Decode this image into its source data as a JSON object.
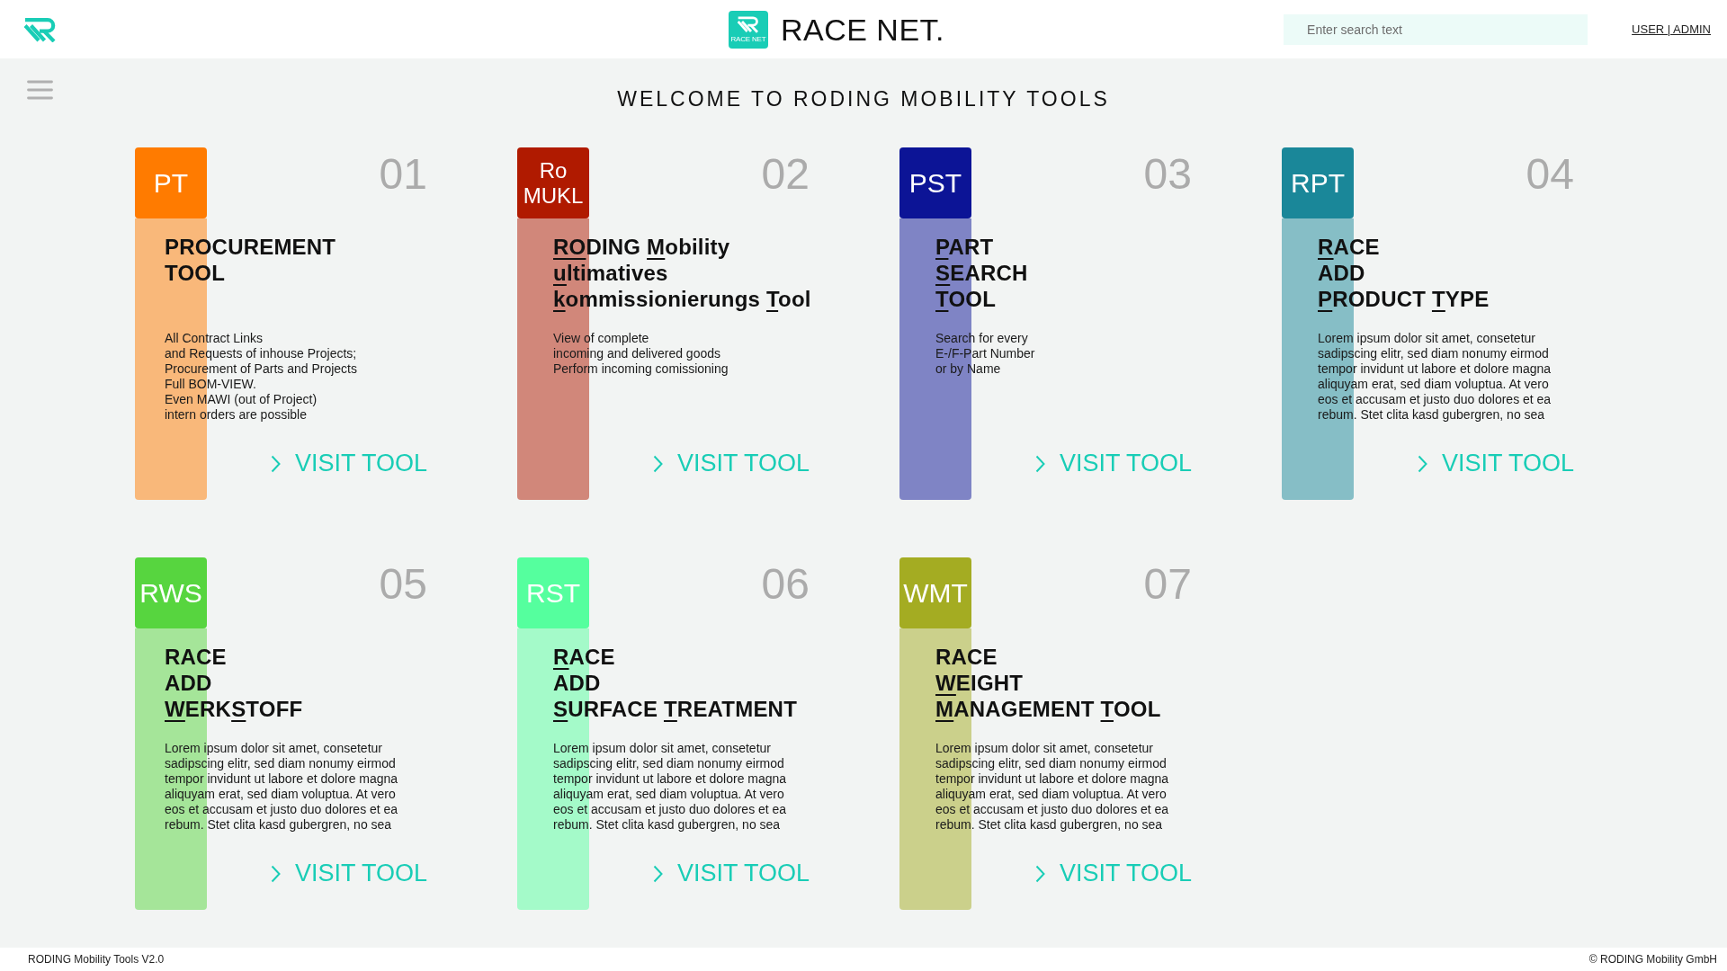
{
  "header": {
    "logo_caption": "RACE NET",
    "brand": "RACE NET.",
    "search": {
      "placeholder": "Enter search text"
    },
    "user_link": "USER | ADMIN"
  },
  "page_title": "WELCOME TO RODING MOBILITY TOOLS",
  "tools": [
    {
      "badge_lines": [
        "PT"
      ],
      "color": "#ff7b00",
      "number": "01",
      "title": [
        [
          {
            "text": "PROCUREMENT",
            "underlined": false
          }
        ],
        [
          {
            "text": "TOOL",
            "underlined": false
          }
        ]
      ],
      "description": [
        "All Contract Links",
        "and Requests of inhouse Projects;",
        "Procurement of Parts and Projects",
        "Full BOM-VIEW.",
        "Even MAWI (out of Project)",
        "intern orders are possible"
      ],
      "link": "VISIT TOOL"
    },
    {
      "badge_lines": [
        "Ro",
        "MUKL"
      ],
      "color": "#b01a00",
      "number": "02",
      "title": [
        [
          {
            "text": "RO",
            "underlined": true
          },
          {
            "text": "DING ",
            "underlined": false
          },
          {
            "text": "M",
            "underlined": true
          },
          {
            "text": "obility",
            "underlined": false
          }
        ],
        [
          {
            "text": "u",
            "underlined": true
          },
          {
            "text": "ltimatives",
            "underlined": false
          }
        ],
        [
          {
            "text": "k",
            "underlined": true
          },
          {
            "text": "ommissionierungs ",
            "underlined": false
          },
          {
            "text": "T",
            "underlined": true
          },
          {
            "text": "ool",
            "underlined": false
          }
        ]
      ],
      "description": [
        "View of complete",
        "incoming and delivered goods",
        "Perform incoming comissioning"
      ],
      "link": "VISIT TOOL"
    },
    {
      "badge_lines": [
        "PST"
      ],
      "color": "#0c1496",
      "number": "03",
      "title": [
        [
          {
            "text": "P",
            "underlined": true
          },
          {
            "text": "ART",
            "underlined": false
          }
        ],
        [
          {
            "text": "S",
            "underlined": true
          },
          {
            "text": "EARCH",
            "underlined": false
          }
        ],
        [
          {
            "text": "T",
            "underlined": true
          },
          {
            "text": "OOL",
            "underlined": false
          }
        ]
      ],
      "description": [
        "Search for every",
        "E-/F-Part Number",
        "or by Name"
      ],
      "link": "VISIT TOOL"
    },
    {
      "badge_lines": [
        "RPT"
      ],
      "color": "#1a8799",
      "number": "04",
      "title": [
        [
          {
            "text": "R",
            "underlined": true
          },
          {
            "text": "ACE",
            "underlined": false
          }
        ],
        [
          {
            "text": "ADD",
            "underlined": false
          }
        ],
        [
          {
            "text": "P",
            "underlined": true
          },
          {
            "text": "RODUCT ",
            "underlined": false
          },
          {
            "text": "T",
            "underlined": true
          },
          {
            "text": "YPE",
            "underlined": false
          }
        ]
      ],
      "description": [
        "Lorem ipsum dolor sit amet, consetetur",
        "sadipscing elitr, sed diam nonumy eirmod",
        "tempor invidunt ut labore et dolore magna",
        "aliquyam erat, sed diam voluptua. At vero",
        "eos et accusam et justo duo dolores et ea",
        "rebum. Stet clita kasd gubergren, no sea"
      ],
      "link": "VISIT TOOL"
    },
    {
      "badge_lines": [
        "RWS"
      ],
      "color": "#57d53f",
      "number": "05",
      "title": [
        [
          {
            "text": "RACE",
            "underlined": false
          }
        ],
        [
          {
            "text": "ADD",
            "underlined": false
          }
        ],
        [
          {
            "text": "W",
            "underlined": true
          },
          {
            "text": "ERK",
            "underlined": false
          },
          {
            "text": "S",
            "underlined": true
          },
          {
            "text": "TOFF",
            "underlined": false
          }
        ]
      ],
      "description": [
        "Lorem ipsum dolor sit amet, consetetur",
        "sadipscing elitr, sed diam nonumy eirmod",
        "tempor invidunt ut labore et dolore magna",
        "aliquyam erat, sed diam voluptua. At vero",
        "eos et accusam et justo duo dolores et ea",
        "rebum. Stet clita kasd gubergren, no sea"
      ],
      "link": "VISIT TOOL"
    },
    {
      "badge_lines": [
        "RST"
      ],
      "color": "#55ff9e",
      "number": "06",
      "title": [
        [
          {
            "text": "R",
            "underlined": true
          },
          {
            "text": "ACE",
            "underlined": false
          }
        ],
        [
          {
            "text": "ADD",
            "underlined": false
          }
        ],
        [
          {
            "text": "S",
            "underlined": true
          },
          {
            "text": "URFACE ",
            "underlined": false
          },
          {
            "text": "T",
            "underlined": true
          },
          {
            "text": "REATMENT",
            "underlined": false
          }
        ]
      ],
      "description": [
        "Lorem ipsum dolor sit amet, consetetur",
        "sadipscing elitr, sed diam nonumy eirmod",
        "tempor invidunt ut labore et dolore magna",
        "aliquyam erat, sed diam voluptua. At vero",
        "eos et accusam et justo duo dolores et ea",
        "rebum. Stet clita kasd gubergren, no sea"
      ],
      "link": "VISIT TOOL"
    },
    {
      "badge_lines": [
        "WMT"
      ],
      "color": "#a4ac22",
      "number": "07",
      "title": [
        [
          {
            "text": "RACE",
            "underlined": false
          }
        ],
        [
          {
            "text": "W",
            "underlined": true
          },
          {
            "text": "EIGHT",
            "underlined": false
          }
        ],
        [
          {
            "text": "M",
            "underlined": true
          },
          {
            "text": "ANAGEMENT ",
            "underlined": false
          },
          {
            "text": "T",
            "underlined": true
          },
          {
            "text": "OOL",
            "underlined": false
          }
        ]
      ],
      "description": [
        "Lorem ipsum dolor sit amet, consetetur",
        "sadipscing elitr, sed diam nonumy eirmod",
        "tempor invidunt ut labore et dolore magna",
        "aliquyam erat, sed diam voluptua. At vero",
        "eos et accusam et justo duo dolores et ea",
        "rebum. Stet clita kasd gubergren, no sea"
      ],
      "link": "VISIT TOOL"
    }
  ],
  "footer": {
    "version": "RODING Mobility Tools V2.0",
    "copyright": "© RODING Mobility GmbH"
  }
}
